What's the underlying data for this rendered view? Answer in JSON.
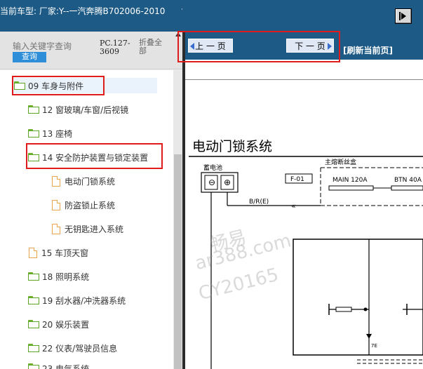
{
  "titlebar": {
    "text": "当前车型:  厂家:Y--一汽奔腾B702006-2010",
    "dot": "·",
    "exit_icon": "exit-icon"
  },
  "search": {
    "placeholder": "输入关键字查询",
    "button_label": "查询",
    "code": "PC.127-3609",
    "collapse_label": "折叠全部"
  },
  "tree": {
    "items": [
      {
        "label": "09 车身与附件",
        "icon": "folder-open-icon"
      },
      {
        "label": "12 窗玻璃/车窗/后视镜",
        "icon": "folder-icon"
      },
      {
        "label": "13 座椅",
        "icon": "folder-icon"
      },
      {
        "label": "14 安全防护装置与锁定装置",
        "icon": "folder-open-icon"
      },
      {
        "label": "电动门锁系统",
        "icon": "page-icon"
      },
      {
        "label": "防盗锁止系统",
        "icon": "page-icon"
      },
      {
        "label": "无钥匙进入系统",
        "icon": "page-icon"
      },
      {
        "label": "15 车顶天窗",
        "icon": "page-icon"
      },
      {
        "label": "18 照明系统",
        "icon": "folder-icon"
      },
      {
        "label": "19 刮水器/冲洗器系统",
        "icon": "folder-icon"
      },
      {
        "label": "20 娱乐装置",
        "icon": "folder-icon"
      },
      {
        "label": "22 仪表/驾驶员信息",
        "icon": "folder-icon"
      },
      {
        "label": "23 电气系统",
        "icon": "folder-icon"
      }
    ]
  },
  "nav": {
    "prev_label": "上 一 页",
    "next_label": "下 一 页",
    "refresh_label": "[刷新当前页]"
  },
  "diagram": {
    "title": "电动门锁系统",
    "battery_label": "蓄电池",
    "main_fusebox_label": "主熔断丝盒",
    "wire_label": "B/R(E)",
    "connector_label": "F-01",
    "fuse1_label": "MAIN 120A",
    "fuse2_label": "BTN 40A",
    "pin_label": "7E"
  },
  "watermark": {
    "line1": "畅易",
    "line2": "ar388.com",
    "line3": "CY20165"
  },
  "colors": {
    "titlebar": "#1d5a86",
    "highlight": "#e01b1b",
    "search_button": "#2f8ed8",
    "folder": "#5ea622",
    "page": "#e8a54b"
  }
}
